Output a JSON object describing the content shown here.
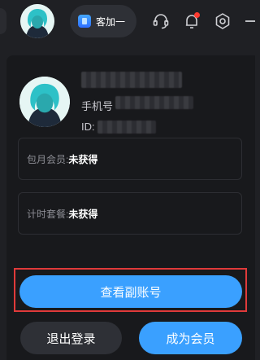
{
  "topbar": {
    "pill_label": "客加一",
    "icons": [
      "support-icon",
      "bell-icon",
      "settings-icon",
      "minimize-icon"
    ],
    "notification_dot_color": "#ff3b30"
  },
  "profile": {
    "phone_label": "手机号",
    "id_label": "ID:"
  },
  "membership": {
    "monthly_label": "包月会员:",
    "monthly_value": "未获得",
    "timed_label": "计时套餐:",
    "timed_value": "未获得"
  },
  "actions": {
    "sub_account_label": "查看副账号",
    "logout_label": "退出登录",
    "become_member_label": "成为会员"
  },
  "colors": {
    "accent": "#3aa0ff",
    "background": "#18191c",
    "highlight_border": "#e03a3a"
  }
}
